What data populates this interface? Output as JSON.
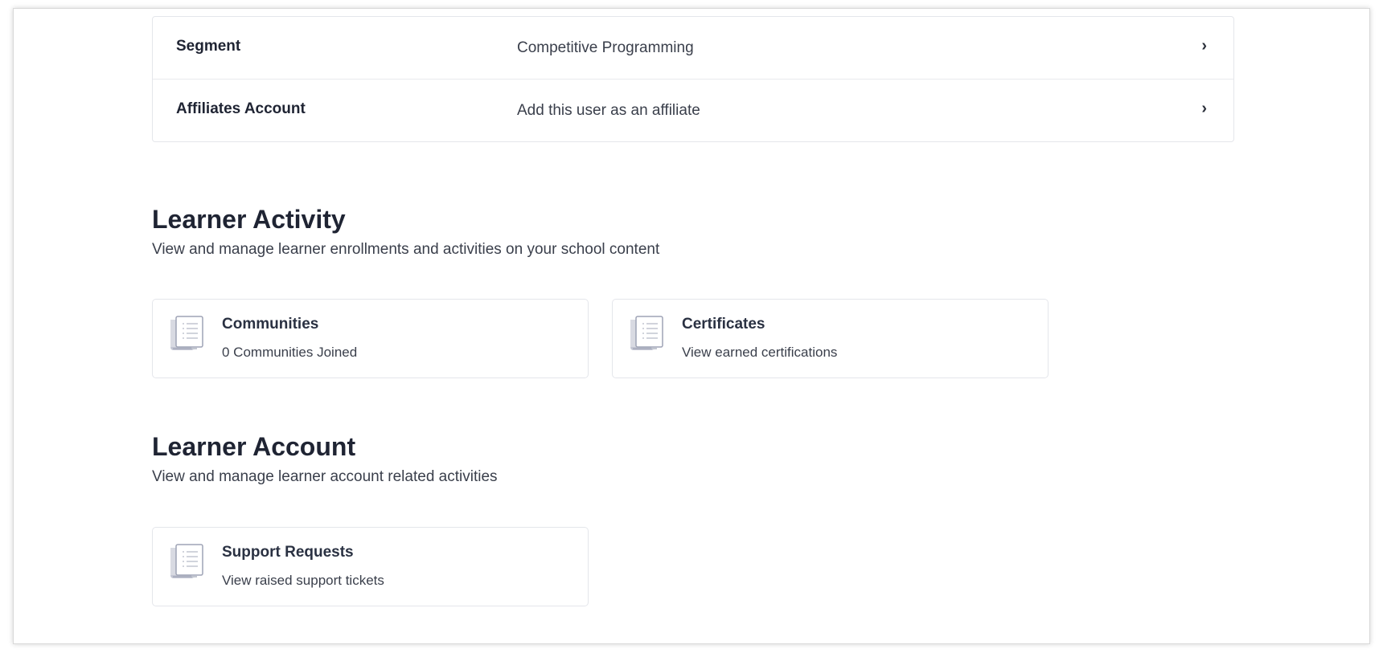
{
  "settings_rows": [
    {
      "label": "Segment",
      "value": "Competitive Programming",
      "chevron": "›"
    },
    {
      "label": "Affiliates Account",
      "value": "Add this user as an affiliate",
      "chevron": "›"
    }
  ],
  "learner_activity": {
    "title": "Learner Activity",
    "description": "View and manage learner enrollments and activities on your school content",
    "cards": [
      {
        "icon": "document-list-icon",
        "title": "Communities",
        "subtitle": "0 Communities Joined"
      },
      {
        "icon": "document-list-icon",
        "title": "Certificates",
        "subtitle": "View earned certifications"
      }
    ]
  },
  "learner_account": {
    "title": "Learner Account",
    "description": "View and manage learner account related activities",
    "cards": [
      {
        "icon": "document-list-icon",
        "title": "Support Requests",
        "subtitle": "View raised support tickets"
      }
    ]
  },
  "colors": {
    "text_primary": "#1f2433",
    "text_secondary": "#3a3f4b",
    "border": "#e4e6eb",
    "icon_fill": "#c9cbd6"
  }
}
